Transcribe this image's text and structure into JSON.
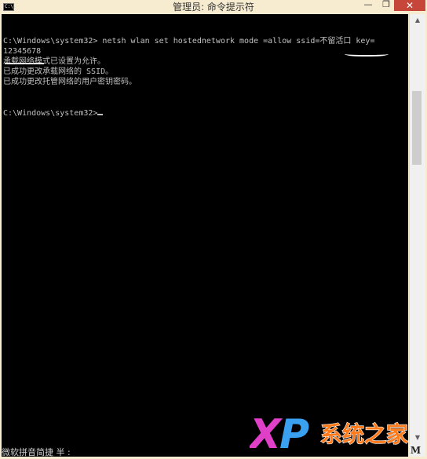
{
  "window": {
    "title": "管理员: 命令提示符",
    "app_icon_text": "C:\\",
    "controls": {
      "minimize": "—",
      "maximize": "❐",
      "close": "✕"
    }
  },
  "console": {
    "lines": [
      "C:\\Windows\\system32> netsh wlan set hostednetwork mode =allow ssid=不留活口 key=",
      "12345678",
      "承载网络模式已设置为允许。",
      "已成功更改承载网络的 SSID。",
      "已成功更改托管网络的用户密钥密码。",
      "C:\\Windows\\system32>"
    ]
  },
  "ime_status": "微软拼音简捷 半 :",
  "corner_badge": "M",
  "watermark": {
    "logo_text": "XP",
    "site_name": "系统之家",
    "colors": {
      "x": "#e040c8",
      "p": "#3aa0f0",
      "text": "#ff7a1a"
    }
  }
}
